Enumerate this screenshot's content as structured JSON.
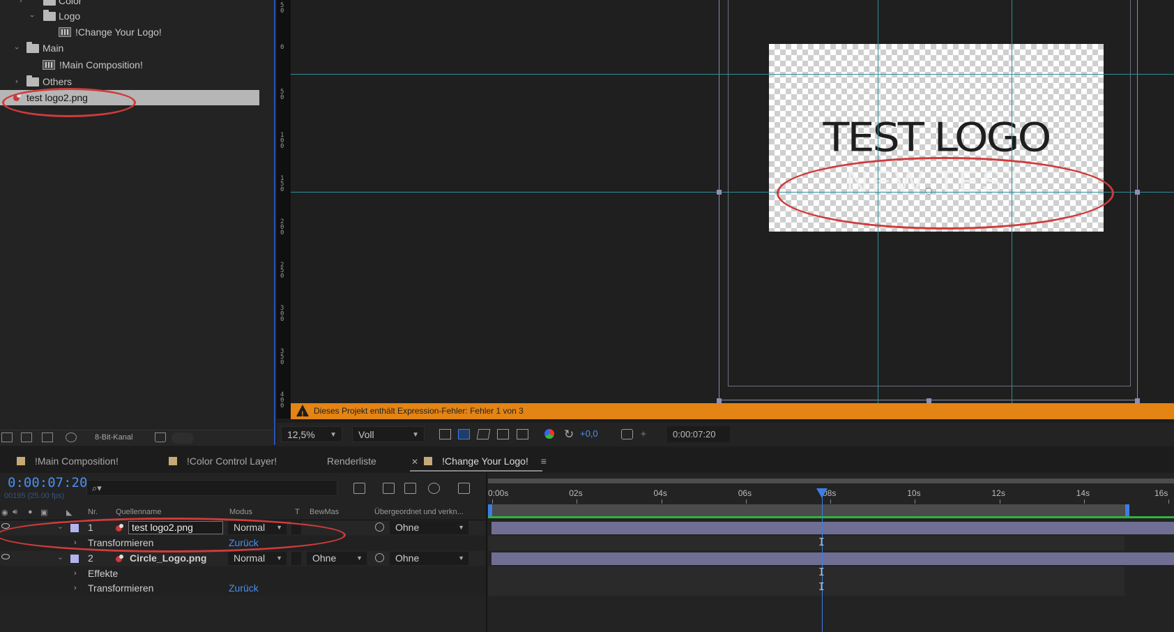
{
  "project_panel": {
    "rows": [
      {
        "label": "Color",
        "type": "folder"
      },
      {
        "label": "Logo",
        "type": "folder"
      },
      {
        "label": "!Change Your Logo!",
        "type": "composition"
      },
      {
        "label": "Main",
        "type": "folder"
      },
      {
        "label": "!Main Composition!",
        "type": "composition"
      },
      {
        "label": "Others",
        "type": "folder"
      },
      {
        "label": "test logo2.png",
        "type": "png",
        "selected": true
      }
    ],
    "footer": {
      "bit_depth": "8-Bit-Kanal"
    }
  },
  "ruler": {
    "labels": [
      "50",
      "0",
      "50",
      "100",
      "150",
      "200",
      "250",
      "300",
      "350",
      "400"
    ]
  },
  "viewer": {
    "logo_text": "TEST LOGO",
    "logo_subtext": "NEW TEST",
    "error_message": "Dieses Projekt enthält Expression-Fehler: Fehler 1 von 3",
    "toolbar": {
      "zoom": "12,5%",
      "resolution": "Voll",
      "exposure": "+0,0",
      "time": "0:00:07:20"
    }
  },
  "tabs": [
    {
      "label": "!Main Composition!",
      "has_swatch": true
    },
    {
      "label": "!Color Control Layer!",
      "has_swatch": true
    },
    {
      "label": "Renderliste",
      "has_swatch": false
    },
    {
      "label": "!Change Your Logo!",
      "has_swatch": true,
      "active": true
    }
  ],
  "timeline": {
    "timecode": "0:00:07:20",
    "fps": "00195 (25.00 fps)",
    "search_placeholder": "",
    "columns": {
      "nr": "Nr.",
      "source": "Quellenname",
      "mode": "Modus",
      "t": "T",
      "trackmatte": "BewMas",
      "parent": "Übergeordnet und verkn..."
    },
    "layers": [
      {
        "nr": "1",
        "name": "test logo2.png",
        "mode": "Normal",
        "trackmatte": "",
        "parent": "Ohne",
        "sub": [
          {
            "label": "Transformieren",
            "link": "Zurück"
          }
        ]
      },
      {
        "nr": "2",
        "name": "Circle_Logo.png",
        "mode": "Normal",
        "trackmatte": "Ohne",
        "parent": "Ohne",
        "sub": [
          {
            "label": "Effekte",
            "link": ""
          },
          {
            "label": "Transformieren",
            "link": "Zurück"
          }
        ]
      }
    ],
    "ruler_labels": [
      "0:00s",
      "02s",
      "04s",
      "06s",
      "08s",
      "10s",
      "12s",
      "14s",
      "16s"
    ],
    "current_time_seconds": 7.8,
    "duration_seconds": 16
  },
  "colors": {
    "accent_blue": "#3c7ee6",
    "timecode_blue": "#4a90ee",
    "error_orange": "#e38414",
    "annotation_red": "#cf3b3b",
    "layer_bar": "#6f6f93",
    "guide_cyan": "#2f8f99"
  }
}
